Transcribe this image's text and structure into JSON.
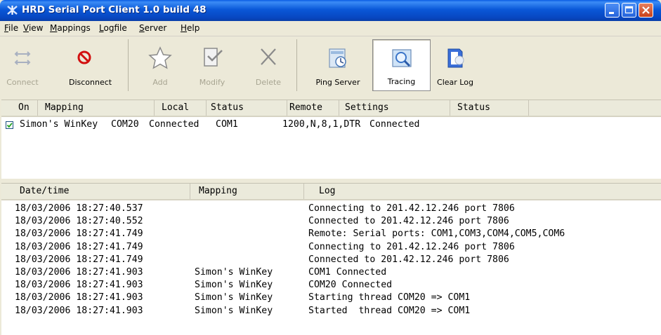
{
  "window": {
    "title": "HRD Serial Port Client 1.0 build 48"
  },
  "menu": [
    "File",
    "View",
    "Mappings",
    "Logfile",
    "Server",
    "Help"
  ],
  "toolbar": {
    "connect": "Connect",
    "disconnect": "Disconnect",
    "add": "Add",
    "modify": "Modify",
    "delete": "Delete",
    "ping_server": "Ping Server",
    "tracing": "Tracing",
    "clear_log": "Clear Log"
  },
  "mapping_list": {
    "columns": [
      "On",
      "Mapping",
      "Local",
      "Status",
      "Remote",
      "Settings",
      "Status"
    ],
    "rows": [
      {
        "on": true,
        "mapping": "Simon's WinKey",
        "local": "COM20",
        "status": "Connected",
        "remote": "COM1",
        "settings": "1200,N,8,1,DTR",
        "remote_status": "Connected"
      }
    ]
  },
  "log": {
    "columns": [
      "Date/time",
      "Mapping",
      "Log"
    ],
    "rows": [
      {
        "datetime": "18/03/2006 18:27:40.537",
        "mapping": "",
        "log": "Connecting to 201.42.12.246 port 7806"
      },
      {
        "datetime": "18/03/2006 18:27:40.552",
        "mapping": "",
        "log": "Connected to 201.42.12.246 port 7806"
      },
      {
        "datetime": "18/03/2006 18:27:41.749",
        "mapping": "",
        "log": "Remote: Serial ports: COM1,COM3,COM4,COM5,COM6"
      },
      {
        "datetime": "18/03/2006 18:27:41.749",
        "mapping": "",
        "log": "Connecting to 201.42.12.246 port 7806"
      },
      {
        "datetime": "18/03/2006 18:27:41.749",
        "mapping": "",
        "log": "Connected to 201.42.12.246 port 7806"
      },
      {
        "datetime": "18/03/2006 18:27:41.903",
        "mapping": "Simon's WinKey",
        "log": "COM1 Connected"
      },
      {
        "datetime": "18/03/2006 18:27:41.903",
        "mapping": "Simon's WinKey",
        "log": "COM20 Connected"
      },
      {
        "datetime": "18/03/2006 18:27:41.903",
        "mapping": "Simon's WinKey",
        "log": "Starting thread COM20 => COM1"
      },
      {
        "datetime": "18/03/2006 18:27:41.903",
        "mapping": "Simon's WinKey",
        "log": "Started  thread COM20 => COM1"
      }
    ]
  }
}
